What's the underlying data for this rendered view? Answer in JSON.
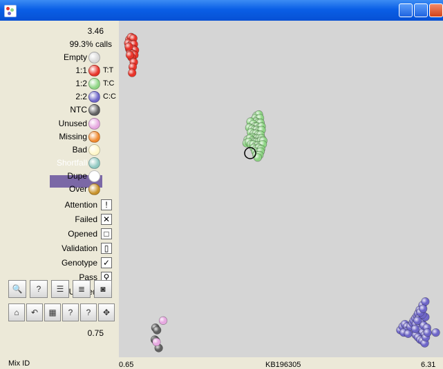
{
  "window": {
    "controls": {
      "minimize": "_",
      "maximize": "□",
      "close": "×"
    }
  },
  "sidebar": {
    "score": "3.46",
    "calls": "99.3% calls",
    "legend": [
      {
        "label": "Empty",
        "color": "#D8D8D8",
        "genotype": ""
      },
      {
        "label": "1:1",
        "color": "#E8342A",
        "genotype": "T:T"
      },
      {
        "label": "1:2",
        "color": "#8FD585",
        "genotype": "T:C"
      },
      {
        "label": "2:2",
        "color": "#6E66C8",
        "genotype": "C:C"
      },
      {
        "label": "NTC",
        "color": "#606060",
        "genotype": ""
      },
      {
        "label": "Unused",
        "color": "#E6A8E0",
        "genotype": ""
      },
      {
        "label": "Missing",
        "color": "#F08A30",
        "genotype": ""
      },
      {
        "label": "Bad",
        "color": "#FFF7C8",
        "genotype": ""
      },
      {
        "label": "Shortfall",
        "color": "#8FC8C0",
        "genotype": ""
      },
      {
        "label": "Dupe",
        "color": "#FFFFFF",
        "genotype": ""
      },
      {
        "label": "Over",
        "color": "#C8922A",
        "genotype": ""
      }
    ],
    "flags": [
      {
        "label": "Attention",
        "icon": "warning-icon",
        "glyph": "!"
      },
      {
        "label": "Failed",
        "icon": "failed-x-icon",
        "glyph": "✕"
      },
      {
        "label": "Opened",
        "icon": "opened-icon",
        "glyph": "□"
      },
      {
        "label": "Validation",
        "icon": "validation-icon",
        "glyph": "▯"
      },
      {
        "label": "Genotype",
        "icon": "genotype-check-icon",
        "glyph": "✓"
      },
      {
        "label": "Pass",
        "icon": "pass-icon",
        "glyph": "⚲"
      },
      {
        "label": "Unseen",
        "icon": "unseen-icon",
        "glyph": "?"
      }
    ],
    "toolbar_row1": [
      {
        "name": "zoom-icon",
        "glyph": "🔍"
      },
      {
        "name": "question-doc-icon",
        "glyph": "?"
      },
      {
        "name": "list-view-icon",
        "glyph": "☰"
      },
      {
        "name": "sliders-icon",
        "glyph": "≣"
      },
      {
        "name": "camera-icon",
        "glyph": "◙"
      }
    ],
    "toolbar_row2": [
      {
        "name": "open-folder-icon",
        "glyph": "⌂"
      },
      {
        "name": "undo-icon",
        "glyph": "↶"
      },
      {
        "name": "grid-icon",
        "glyph": "▦"
      },
      {
        "name": "help-question-icon",
        "glyph": "?"
      },
      {
        "name": "help-question-icon-2",
        "glyph": "?"
      },
      {
        "name": "fit-arrows-icon",
        "glyph": "✥"
      }
    ],
    "y_value": "0.75"
  },
  "footer": {
    "mix_id_label": "Mix ID",
    "x_min": "0.65",
    "x_label": "KB196305",
    "x_max": "6.31"
  },
  "chart_data": {
    "type": "scatter",
    "title": "",
    "xlabel": "KB196305",
    "ylabel": "",
    "xlim": [
      0.65,
      6.31
    ],
    "ylim": [
      0.75,
      3.46
    ],
    "grid": false,
    "series": [
      {
        "name": "1:1",
        "color": "#E8342A",
        "points": [
          [
            0.74,
            3.36
          ],
          [
            0.77,
            3.38
          ],
          [
            0.81,
            3.37
          ],
          [
            0.72,
            3.33
          ],
          [
            0.76,
            3.31
          ],
          [
            0.79,
            3.32
          ],
          [
            0.82,
            3.32
          ],
          [
            0.74,
            3.28
          ],
          [
            0.78,
            3.28
          ],
          [
            0.81,
            3.28
          ],
          [
            0.84,
            3.27
          ],
          [
            0.76,
            3.25
          ],
          [
            0.8,
            3.24
          ],
          [
            0.83,
            3.23
          ],
          [
            0.78,
            3.21
          ],
          [
            0.82,
            3.17
          ],
          [
            0.8,
            3.13
          ],
          [
            0.79,
            3.08
          ],
          [
            0.73,
            3.3
          ],
          [
            0.75,
            3.23
          ]
        ]
      },
      {
        "name": "1:2",
        "color": "#8FD585",
        "points": [
          [
            3.04,
            2.72
          ],
          [
            3.08,
            2.73
          ],
          [
            3.02,
            2.7
          ],
          [
            3.06,
            2.69
          ],
          [
            3.1,
            2.7
          ],
          [
            3.03,
            2.67
          ],
          [
            3.07,
            2.66
          ],
          [
            3.11,
            2.66
          ],
          [
            2.93,
            2.67
          ],
          [
            2.98,
            2.65
          ],
          [
            3.01,
            2.63
          ],
          [
            3.05,
            2.63
          ],
          [
            3.09,
            2.62
          ],
          [
            3.13,
            2.63
          ],
          [
            2.91,
            2.62
          ],
          [
            2.96,
            2.61
          ],
          [
            3.0,
            2.6
          ],
          [
            3.04,
            2.6
          ],
          [
            3.08,
            2.59
          ],
          [
            3.13,
            2.6
          ],
          [
            2.94,
            2.58
          ],
          [
            2.99,
            2.57
          ],
          [
            3.03,
            2.57
          ],
          [
            3.07,
            2.56
          ],
          [
            3.11,
            2.56
          ],
          [
            2.97,
            2.54
          ],
          [
            3.01,
            2.53
          ],
          [
            3.05,
            2.53
          ],
          [
            3.09,
            2.53
          ],
          [
            3.13,
            2.53
          ],
          [
            2.88,
            2.52
          ],
          [
            2.92,
            2.53
          ],
          [
            2.96,
            2.51
          ],
          [
            3.0,
            2.5
          ],
          [
            3.04,
            2.5
          ],
          [
            3.08,
            2.5
          ],
          [
            3.12,
            2.51
          ],
          [
            3.16,
            2.51
          ],
          [
            2.86,
            2.49
          ],
          [
            2.9,
            2.5
          ],
          [
            2.94,
            2.48
          ],
          [
            2.98,
            2.48
          ],
          [
            3.03,
            2.47
          ],
          [
            3.06,
            2.47
          ],
          [
            3.11,
            2.47
          ],
          [
            3.15,
            2.48
          ],
          [
            2.99,
            2.45
          ],
          [
            3.03,
            2.44
          ],
          [
            3.08,
            2.45
          ],
          [
            3.12,
            2.44
          ],
          [
            3.02,
            2.42
          ],
          [
            3.06,
            2.41
          ],
          [
            3.11,
            2.42
          ],
          [
            3.04,
            2.39
          ],
          [
            3.09,
            2.39
          ],
          [
            3.06,
            2.37
          ]
        ]
      },
      {
        "name": "2:2",
        "color": "#6E66C8",
        "points": [
          [
            5.64,
            0.92
          ],
          [
            5.68,
            0.95
          ],
          [
            5.72,
            0.97
          ],
          [
            5.76,
            0.95
          ],
          [
            5.8,
            0.93
          ],
          [
            5.84,
            0.91
          ],
          [
            5.74,
            0.91
          ],
          [
            5.7,
            0.9
          ],
          [
            5.78,
            0.89
          ],
          [
            5.82,
            0.95
          ],
          [
            5.86,
            0.98
          ],
          [
            5.88,
            1.0
          ],
          [
            5.91,
            1.02
          ],
          [
            5.94,
            1.04
          ],
          [
            5.96,
            1.06
          ],
          [
            5.99,
            1.09
          ],
          [
            5.92,
            0.97
          ],
          [
            5.96,
            0.94
          ],
          [
            6.0,
            0.92
          ],
          [
            6.04,
            0.9
          ],
          [
            6.08,
            0.88
          ],
          [
            5.92,
            0.88
          ],
          [
            5.96,
            0.86
          ],
          [
            6.0,
            0.84
          ],
          [
            6.04,
            0.83
          ],
          [
            6.08,
            0.81
          ],
          [
            5.98,
            1.02
          ],
          [
            6.02,
            0.99
          ],
          [
            6.06,
            0.96
          ],
          [
            6.09,
            1.03
          ],
          [
            6.12,
            0.94
          ],
          [
            6.1,
            0.86
          ],
          [
            6.13,
            0.9
          ],
          [
            6.04,
            1.05
          ],
          [
            5.95,
            1.0
          ],
          [
            6.0,
            1.07
          ],
          [
            6.04,
            1.13
          ],
          [
            6.09,
            1.16
          ],
          [
            6.05,
            1.1
          ],
          [
            5.91,
            0.93
          ],
          [
            6.28,
            0.9
          ]
        ]
      },
      {
        "name": "NTC",
        "color": "#606060",
        "points": [
          [
            1.21,
            0.94
          ],
          [
            1.24,
            0.92
          ],
          [
            1.2,
            0.84
          ],
          [
            1.22,
            0.83
          ],
          [
            1.27,
            0.77
          ]
        ]
      },
      {
        "name": "Unused",
        "color": "#E6A8E0",
        "points": [
          [
            1.35,
            1.0
          ],
          [
            1.23,
            0.82
          ]
        ]
      }
    ]
  }
}
